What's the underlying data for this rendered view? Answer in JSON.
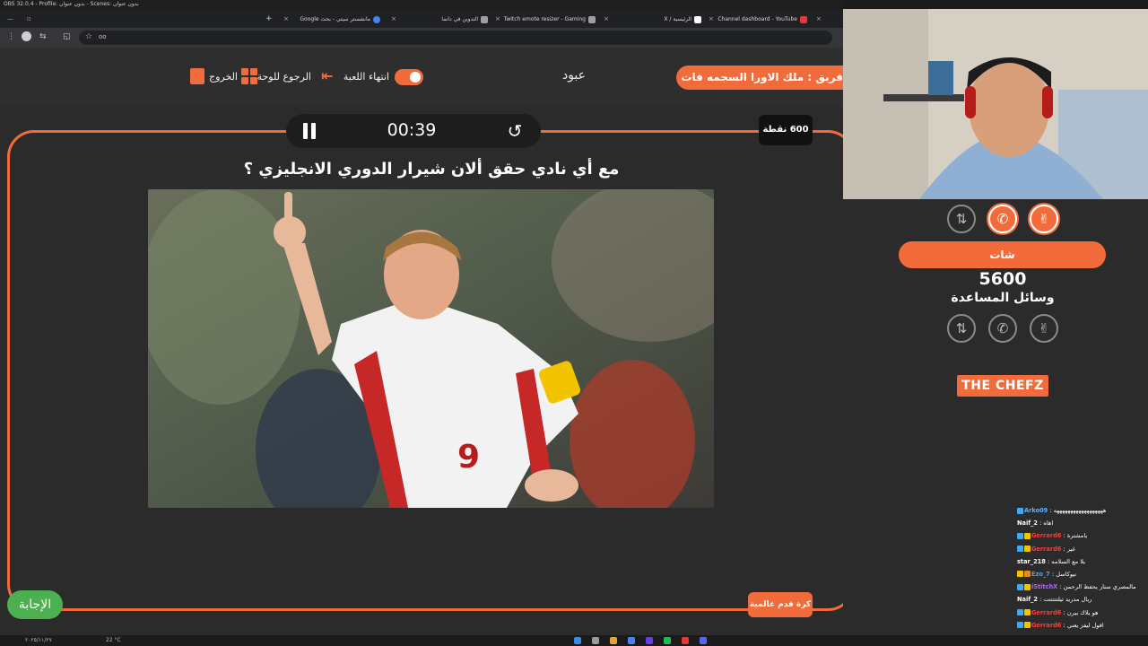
{
  "obs": {
    "title": "OBS 32.0.4 - Profile: بدون عنوان - Scenes: بدون عنوان"
  },
  "browser": {
    "tabs": [
      {
        "label": "Channel dashboard - YouTube",
        "color": "#e53935"
      },
      {
        "label": "الرئيسية / X",
        "color": "#ffffff"
      },
      {
        "label": "Twitch emote resizer - Gaming",
        "color": "#9e9e9e"
      },
      {
        "label": "التدوين في داتما",
        "color": "#9e9e9e"
      },
      {
        "label": "مانشستر سيتي - بحث Google",
        "color": "#4285f4"
      }
    ],
    "new_tab": "+",
    "close": "×",
    "address_text": "oo"
  },
  "header": {
    "team_label": "فريق : ملك الاورا السجمه فات",
    "player_name": "عبود",
    "end_game": "انتهاء اللعبة",
    "back_to_board": "الرجوع للوحة",
    "exit": "الخروج"
  },
  "game": {
    "timer": "00:39",
    "points": "600 نقطة",
    "question": "مع أي نادي حقق ألان شيرار الدوري الانجليزي ؟",
    "category": "كرة قدم عالمية",
    "answer_button": "الإجابة"
  },
  "panel": {
    "chat_button": "شات",
    "score": "5600",
    "lifelines_label": "وسائل المساعدة",
    "brand_the": "THE",
    "brand_name": "CHEFZ"
  },
  "chat": [
    {
      "user": "Arko09",
      "msg": ": ههههههههههههههههههه",
      "color": "#5fb0ff"
    },
    {
      "user": "Naif_2",
      "msg": ": اهاه",
      "color": "#ffffff"
    },
    {
      "user": "Gerrard6",
      "msg": ": يامشترة",
      "color": "#ff3b3b"
    },
    {
      "user": "Gerrard6",
      "msg": ": غير",
      "color": "#ff3b3b"
    },
    {
      "user": "star_218",
      "msg": ": يلا مع السلامه",
      "color": "#ffffff"
    },
    {
      "user": "Ezo_7",
      "msg": ": نيوكاسل",
      "color": "#3fa9f5"
    },
    {
      "user": "iStitchX",
      "msg": ": مالمصري ستار يحفظ الرحمن",
      "color": "#b266ff"
    },
    {
      "user": "Naif_2",
      "msg": ": ريال مدريد ثيلتتتتتت",
      "color": "#ffffff"
    },
    {
      "user": "Gerrard6",
      "msg": ": هو يلاك بيرن",
      "color": "#ff3b3b"
    },
    {
      "user": "Gerrard6",
      "msg": ": اقول ليفز يعني",
      "color": "#ff3b3b"
    }
  ],
  "taskbar": {
    "weather": "22 °C",
    "date": "٢٠٢٥/١١/٢٧"
  },
  "colors": {
    "accent": "#f26b3a",
    "answer": "#4caf50",
    "background": "#2b2b2b"
  }
}
